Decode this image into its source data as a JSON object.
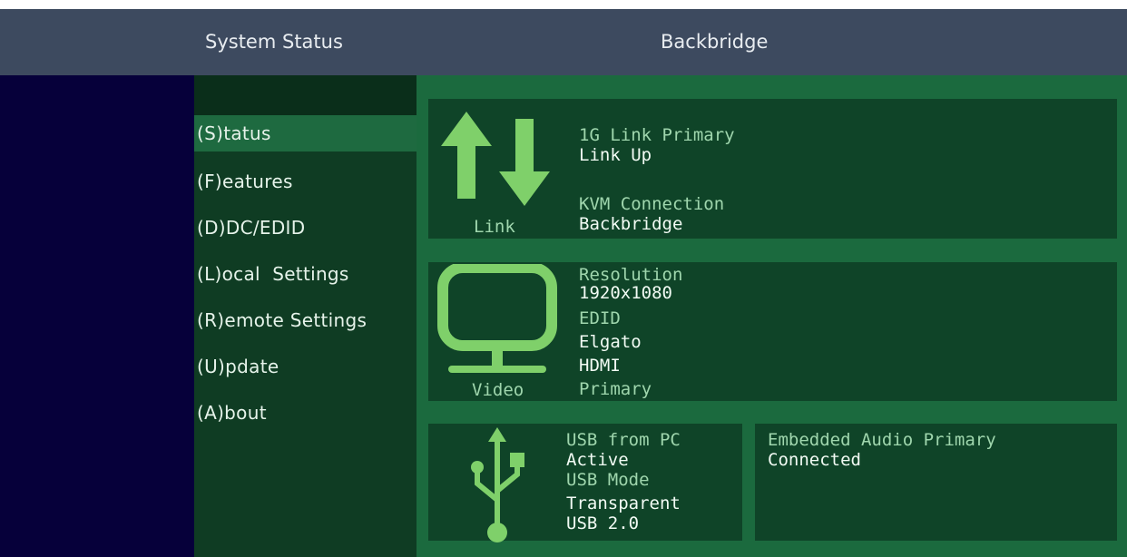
{
  "header": {
    "section_title": "System Status",
    "device_name": "Backbridge"
  },
  "menu": {
    "items": [
      {
        "label": "(S)tatus"
      },
      {
        "label": "(F)eatures"
      },
      {
        "label": "(D)DC/EDID"
      },
      {
        "label": "(L)ocal  Settings"
      },
      {
        "label": "(R)emote Settings"
      },
      {
        "label": "(U)pdate"
      },
      {
        "label": "(A)bout"
      }
    ]
  },
  "link": {
    "caption": "Link",
    "icon": "link-arrows-icon",
    "primary_label": "1G Link Primary",
    "primary_value": "Link Up",
    "kvm_label": "KVM Connection",
    "kvm_value": "Backbridge"
  },
  "video": {
    "caption": "Video",
    "icon": "monitor-icon",
    "resolution_label": "Resolution",
    "resolution_value": "1920x1080",
    "edid_label": "EDID",
    "edid_value": "Elgato",
    "interface_value": "HDMI",
    "interface_role": "Primary"
  },
  "usb": {
    "icon": "usb-icon",
    "from_pc_label": "USB from PC",
    "from_pc_value": "Active",
    "mode_label": "USB Mode",
    "mode_value": "Transparent",
    "version_value": "USB 2.0"
  },
  "audio": {
    "label": "Embedded Audio Primary",
    "value": "Connected"
  },
  "colors": {
    "header_bg": "#3d4a5f",
    "left_band": "#06003a",
    "sidebar_bg": "#0f3c23",
    "active_item": "#1e6a40",
    "main_bg": "#1b6a3e",
    "panel_bg": "#0f4428",
    "icon_green": "#7fd06a"
  }
}
